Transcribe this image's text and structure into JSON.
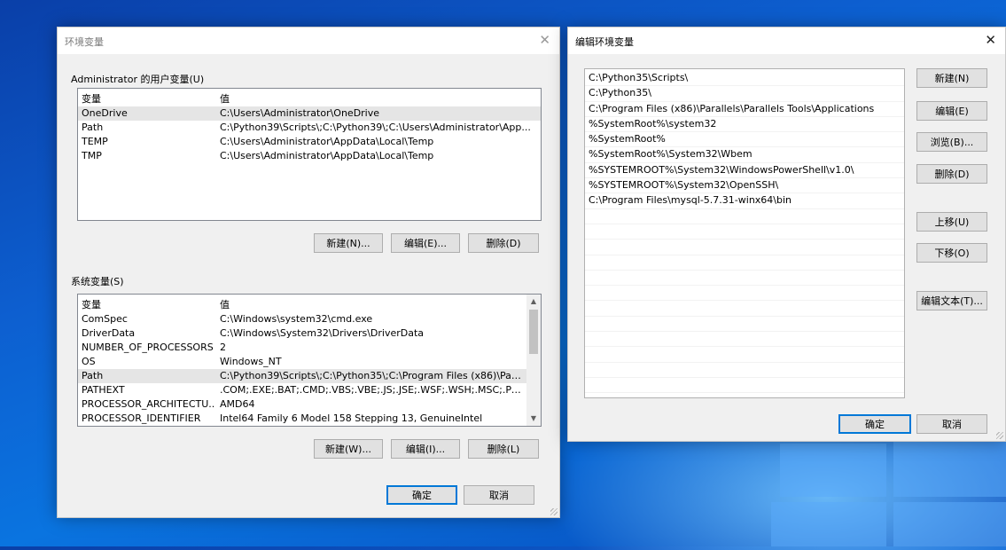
{
  "env_dialog": {
    "title": "环境变量",
    "user_section_label": "Administrator 的用户变量(U)",
    "col_var": "变量",
    "col_val": "值",
    "user_vars": [
      {
        "name": "OneDrive",
        "value": "C:\\Users\\Administrator\\OneDrive"
      },
      {
        "name": "Path",
        "value": "C:\\Python39\\Scripts\\;C:\\Python39\\;C:\\Users\\Administrator\\App..."
      },
      {
        "name": "TEMP",
        "value": "C:\\Users\\Administrator\\AppData\\Local\\Temp"
      },
      {
        "name": "TMP",
        "value": "C:\\Users\\Administrator\\AppData\\Local\\Temp"
      }
    ],
    "user_buttons": {
      "new": "新建(N)...",
      "edit": "编辑(E)...",
      "delete": "删除(D)"
    },
    "system_section_label": "系统变量(S)",
    "system_vars": [
      {
        "name": "ComSpec",
        "value": "C:\\Windows\\system32\\cmd.exe"
      },
      {
        "name": "DriverData",
        "value": "C:\\Windows\\System32\\Drivers\\DriverData"
      },
      {
        "name": "NUMBER_OF_PROCESSORS",
        "value": "2"
      },
      {
        "name": "OS",
        "value": "Windows_NT"
      },
      {
        "name": "Path",
        "value": "C:\\Python39\\Scripts\\;C:\\Python35\\;C:\\Program Files (x86)\\Parall..."
      },
      {
        "name": "PATHEXT",
        "value": ".COM;.EXE;.BAT;.CMD;.VBS;.VBE;.JS;.JSE;.WSF;.WSH;.MSC;.PY;.PY..."
      },
      {
        "name": "PROCESSOR_ARCHITECTU...",
        "value": "AMD64"
      },
      {
        "name": "PROCESSOR_IDENTIFIER",
        "value": "Intel64 Family 6 Model 158 Stepping 13, GenuineIntel"
      }
    ],
    "system_buttons": {
      "new": "新建(W)...",
      "edit": "编辑(I)...",
      "delete": "删除(L)"
    },
    "ok": "确定",
    "cancel": "取消"
  },
  "edit_dialog": {
    "title": "编辑环境变量",
    "paths": [
      "C:\\Python35\\Scripts\\",
      "C:\\Python35\\",
      "C:\\Program Files (x86)\\Parallels\\Parallels Tools\\Applications",
      "%SystemRoot%\\system32",
      "%SystemRoot%",
      "%SystemRoot%\\System32\\Wbem",
      "%SYSTEMROOT%\\System32\\WindowsPowerShell\\v1.0\\",
      "%SYSTEMROOT%\\System32\\OpenSSH\\",
      "C:\\Program Files\\mysql-5.7.31-winx64\\bin"
    ],
    "buttons": {
      "new": "新建(N)",
      "edit": "编辑(E)",
      "browse": "浏览(B)...",
      "delete": "删除(D)",
      "move_up": "上移(U)",
      "move_down": "下移(O)",
      "edit_text": "编辑文本(T)..."
    },
    "ok": "确定",
    "cancel": "取消"
  }
}
